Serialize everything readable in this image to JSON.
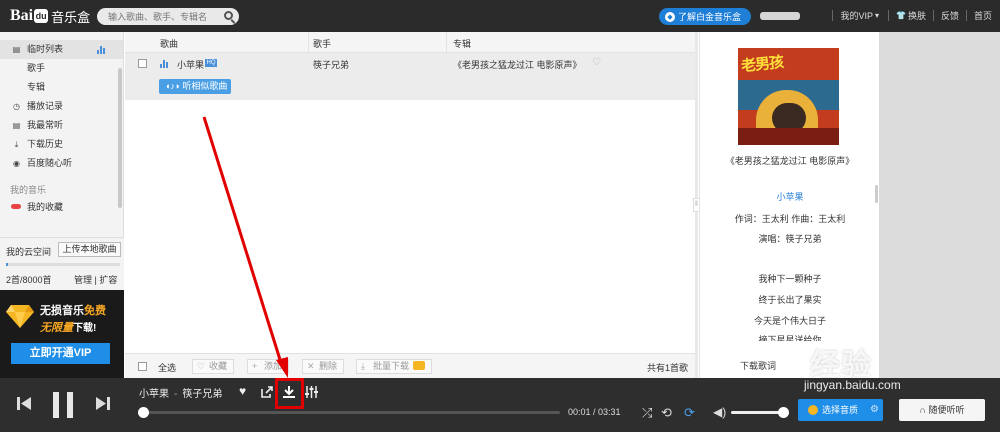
{
  "topbar": {
    "logo_bai": "Bai",
    "logo_paw": "du",
    "logo_app": "音乐盒",
    "search_placeholder": "输入歌曲、歌手、专辑名",
    "vip_pill": "了解白金音乐盒",
    "nav": [
      "我的VIP",
      "换肤",
      "反馈",
      "首页"
    ]
  },
  "sidebar": {
    "items": [
      {
        "label": "临时列表",
        "icon": "list-icon"
      },
      {
        "label": "歌手",
        "icon": ""
      },
      {
        "label": "专辑",
        "icon": ""
      },
      {
        "label": "播放记录",
        "icon": "history-icon"
      },
      {
        "label": "我最常听",
        "icon": "list-icon"
      },
      {
        "label": "下载历史",
        "icon": "download-icon"
      },
      {
        "label": "百度随心听",
        "icon": "compass-icon"
      }
    ],
    "my_music_heading": "我的音乐",
    "favorites": "我的收藏"
  },
  "cloud": {
    "title": "我的云空间",
    "upload": "上传本地歌曲",
    "usage_fraction": 0.0025,
    "count": "2首/8000首",
    "manage": "管理 | 扩容"
  },
  "promo": {
    "line1_a": "无损音乐",
    "line1_b": "免费",
    "line2_a": "无限量",
    "line2_b": "下载!",
    "button": "立即开通VIP"
  },
  "list": {
    "columns": [
      "歌曲",
      "歌手",
      "专辑"
    ],
    "rows": [
      {
        "song": "小苹果",
        "quality": "HQ",
        "singer": "筷子兄弟",
        "album": "《老男孩之猛龙过江 电影原声》",
        "similar": "听相似歌曲"
      }
    ],
    "footer": {
      "select_all": "全选",
      "buttons": [
        "收藏",
        "添加",
        "删除",
        "批量下载"
      ],
      "total": "共有1首歌"
    }
  },
  "right": {
    "cover_title": "老男孩",
    "album_caption": "《老男孩之猛龙过江 电影原声》",
    "lyric_title": "小苹果",
    "lyrics": [
      "作词：王太利  作曲：王太利",
      "演唱：筷子兄弟",
      "",
      "我种下一颗种子",
      "终于长出了果实",
      "今天是个伟大日子",
      "摘下星星送给你"
    ],
    "lower_text": "下载歌词"
  },
  "player": {
    "song": "小苹果",
    "artist": "筷子兄弟",
    "time": "00:01 / 03:31",
    "quality_btn": "选择音质",
    "listen_btn": "随便听听",
    "progress_fraction": 0.005,
    "volume_fraction": 1.0
  },
  "watermark": {
    "text": "经验",
    "url": "jingyan.baidu.com"
  },
  "colors": {
    "accent": "#1f8ee8",
    "annotation": "#e00000",
    "topbar": "#2b2b2b",
    "player": "#2e2e2e"
  }
}
